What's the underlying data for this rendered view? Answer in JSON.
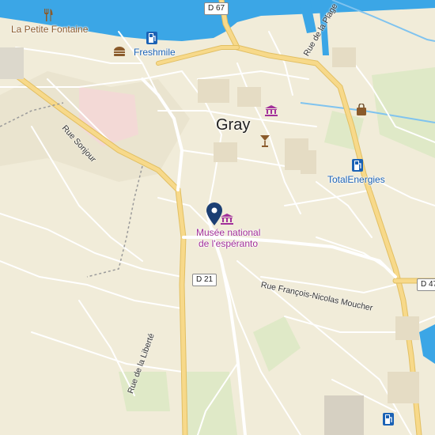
{
  "map": {
    "city_label": "Gray",
    "colors": {
      "land": "#f1ecd9",
      "water": "#3ba6e6",
      "road_major": "#f7d98a",
      "road_minor": "#ffffff",
      "park": "#dfe9c7",
      "pin": "#1c3f73",
      "fuel": "#1b62b5",
      "museum": "#a2309a",
      "food": "#8a5a2b"
    },
    "pois": [
      {
        "name": "La Petite Fontaine",
        "icon": "restaurant-icon",
        "type": "food"
      },
      {
        "name": "Freshmile",
        "icon": "fuel-icon",
        "type": "fuel"
      },
      {
        "name": "TotalEnergies",
        "icon": "fuel-icon",
        "type": "fuel"
      },
      {
        "name": "Musée national de l'espéranto",
        "line1": "Musée national",
        "line2": "de l'espéranto",
        "icon": "museum-icon",
        "type": "museum"
      }
    ],
    "streets": {
      "rue_de_la_plage": "Rue de la Plage",
      "rue_sonjour": "Rue Sonjour",
      "rue_francois": "Rue François-Nicolas Moucher",
      "rue_liberte": "Rue de la Liberté"
    },
    "shields": {
      "d67": "D 67",
      "d21": "D 21",
      "d47": "D 47"
    }
  }
}
